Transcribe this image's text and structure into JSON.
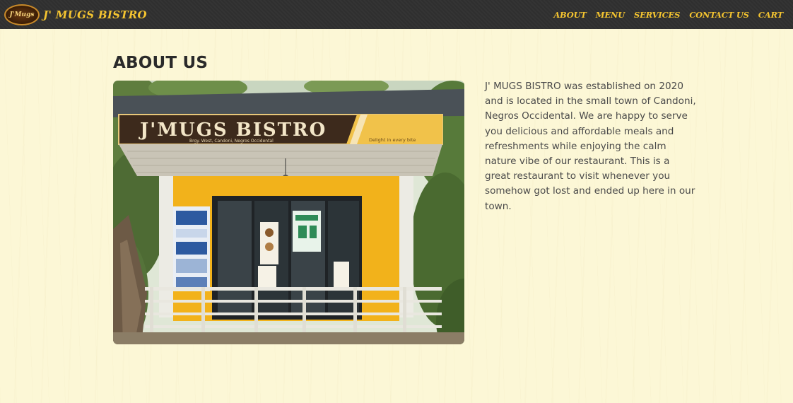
{
  "navbar": {
    "brand_name": "J' MUGS BISTRO",
    "logo_text": "J'Mugs",
    "links": [
      "ABOUT",
      "MENU",
      "SERVICES",
      "CONTACT US",
      "CART"
    ]
  },
  "about": {
    "title": "ABOUT US",
    "paragraph": "J' MUGS BISTRO was established on 2020 and is located in the small town of Candoni, Negros Occidental. We are happy to serve you delicious and affordable meals and refreshments while enjoying the calm nature vibe of our restaurant. This is a great restaurant to visit whenever you somehow got lost and ended up here in our town.",
    "photo": {
      "sign_text": "J'MUGS BISTRO",
      "sign_subtext": "Brgy. West, Candoni, Negros Occidental",
      "sign_tagline": "Delight in every bite"
    }
  },
  "colors": {
    "navbar_bg": "#2f2f2f",
    "accent_yellow": "#f4c430",
    "page_bg": "#fcf7d6",
    "title_text": "#2a2a2a",
    "body_text": "#4a4a4a"
  }
}
